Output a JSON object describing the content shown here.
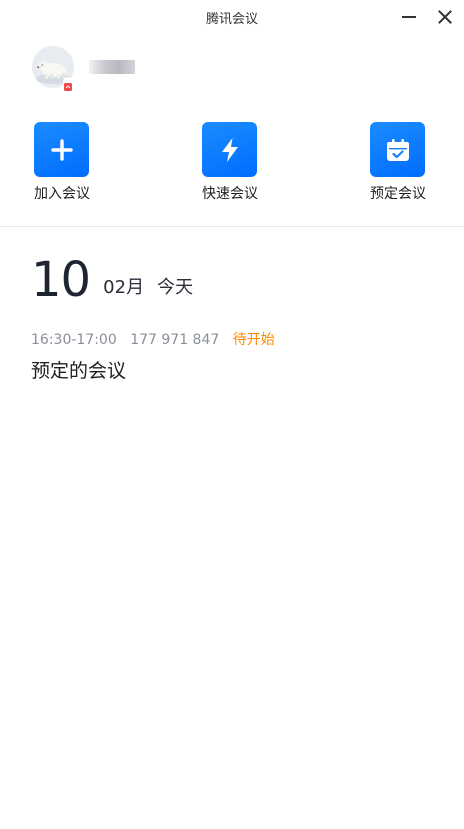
{
  "window": {
    "title": "腾讯会议"
  },
  "profile": {
    "avatar_icon": "polar-bear-avatar",
    "username": ""
  },
  "actions": [
    {
      "label": "加入会议",
      "icon": "plus-icon"
    },
    {
      "label": "快速会议",
      "icon": "lightning-icon"
    },
    {
      "label": "预定会议",
      "icon": "calendar-check-icon"
    }
  ],
  "date": {
    "day": "10",
    "month": "02月",
    "relative": "今天"
  },
  "meetings": [
    {
      "time": "16:30-17:00",
      "id": "177 971 847",
      "status": "待开始",
      "title": "预定的会议"
    }
  ],
  "colors": {
    "accent": "#0a72ff",
    "status_pending": "#ff8a00"
  }
}
